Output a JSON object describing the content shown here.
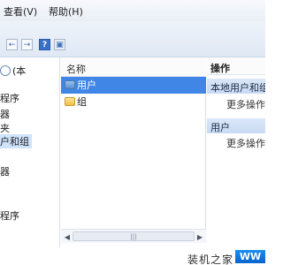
{
  "menu": {
    "items": [
      {
        "label": "查看(V)"
      },
      {
        "label": "帮助(H)"
      }
    ]
  },
  "toolbar": {
    "buttons": [
      {
        "label": "←"
      },
      {
        "label": "→"
      },
      {
        "label": "?"
      },
      {
        "label": "▣"
      }
    ]
  },
  "left_panel": {
    "items": [
      {
        "label": "(本"
      },
      {
        "label": "程序"
      },
      {
        "label": "器"
      },
      {
        "label": "夹"
      },
      {
        "label": "户和组"
      },
      {
        "label": "器"
      },
      {
        "label": "程序"
      }
    ]
  },
  "list": {
    "column_header": "名称",
    "rows": [
      {
        "label": "用户"
      },
      {
        "label": "组"
      }
    ]
  },
  "actions": {
    "title": "操作",
    "sections": [
      {
        "title": "本地用户和组",
        "action": "更多操作"
      },
      {
        "title": "用户",
        "action": "更多操作"
      }
    ]
  },
  "watermark": {
    "text": "装机之家",
    "badge": "WW"
  }
}
